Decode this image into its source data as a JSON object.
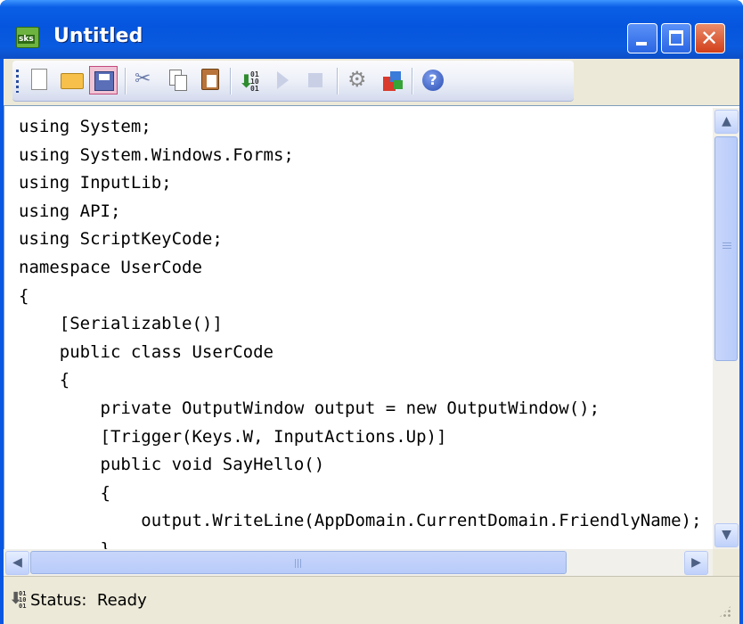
{
  "window": {
    "title": "Untitled",
    "icon_text": "sks",
    "controls": {
      "minimize": "minimize",
      "maximize": "maximize",
      "close": "✕"
    }
  },
  "toolbar": {
    "items": [
      {
        "icon": "new-file-icon",
        "label": "New"
      },
      {
        "icon": "open-folder-icon",
        "label": "Open"
      },
      {
        "icon": "save-icon",
        "label": "Save",
        "active": true
      },
      {
        "icon": "cut-icon",
        "label": "Cut"
      },
      {
        "icon": "copy-icon",
        "label": "Copy"
      },
      {
        "icon": "paste-icon",
        "label": "Paste"
      },
      {
        "icon": "compile-icon",
        "label": "Compile",
        "bits": "01\n10\n01"
      },
      {
        "icon": "run-icon",
        "label": "Run"
      },
      {
        "icon": "stop-icon",
        "label": "Stop"
      },
      {
        "icon": "settings-icon",
        "label": "Settings"
      },
      {
        "icon": "tools-icon",
        "label": "Tools"
      },
      {
        "icon": "help-icon",
        "label": "?"
      }
    ]
  },
  "editor": {
    "lines": [
      "using System;",
      "using System.Windows.Forms;",
      "using InputLib;",
      "using API;",
      "using ScriptKeyCode;",
      "namespace UserCode",
      "{",
      "    [Serializable()]",
      "    public class UserCode",
      "    {",
      "        private OutputWindow output = new OutputWindow();",
      "",
      "        [Trigger(Keys.W, InputActions.Up)]",
      "        public void SayHello()",
      "        {",
      "            output.WriteLine(AppDomain.CurrentDomain.FriendlyName);",
      "        }"
    ]
  },
  "scrollbars": {
    "up": "▲",
    "down": "▼",
    "left": "◀",
    "right": "▶"
  },
  "status": {
    "label": "Status:",
    "value": "Ready",
    "text": "Status:  Ready",
    "bits": "01\n10\n01"
  },
  "colors": {
    "titlebar": "#0A5FE6",
    "close_button": "#D23F19",
    "toolbar_bg": "#ECE9D8",
    "scroll_thumb": "#C8D6FB"
  }
}
